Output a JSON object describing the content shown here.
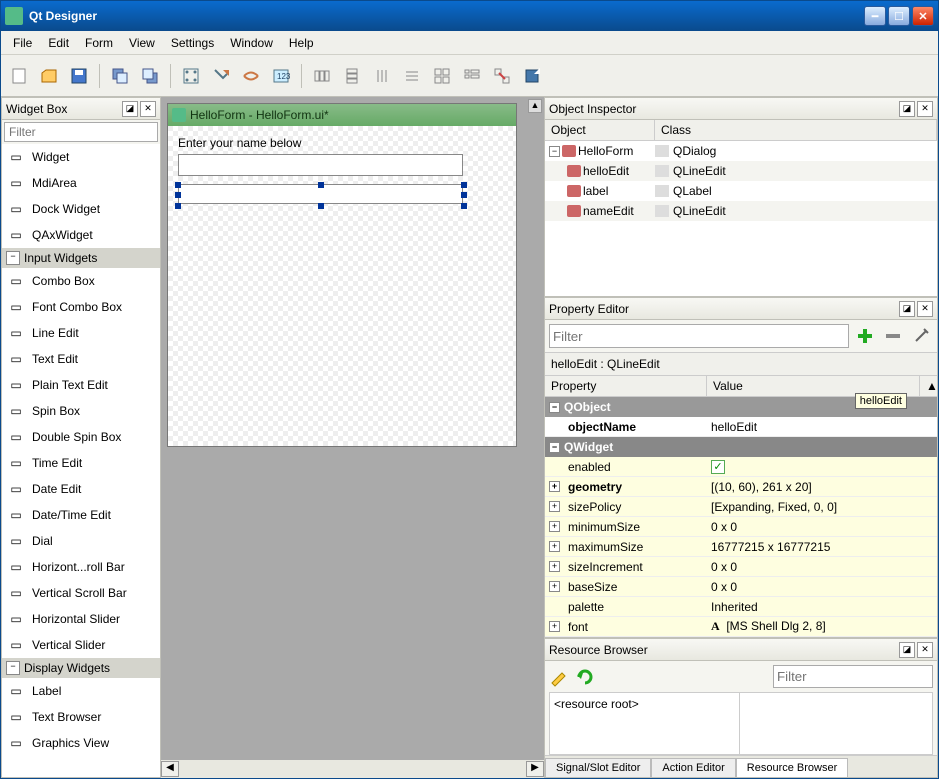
{
  "app_title": "Qt Designer",
  "menu": [
    "File",
    "Edit",
    "Form",
    "View",
    "Settings",
    "Window",
    "Help"
  ],
  "widgetbox": {
    "title": "Widget Box",
    "filter_placeholder": "Filter",
    "items": [
      {
        "icon": "widget-icon",
        "label": "Widget"
      },
      {
        "icon": "mdiarea-icon",
        "label": "MdiArea"
      },
      {
        "icon": "dockwidget-icon",
        "label": "Dock Widget"
      },
      {
        "icon": "axwidget-icon",
        "label": "QAxWidget"
      }
    ],
    "cat1": "Input Widgets",
    "input_items": [
      {
        "icon": "combobox-icon",
        "label": "Combo Box"
      },
      {
        "icon": "fontcombo-icon",
        "label": "Font Combo Box"
      },
      {
        "icon": "lineedit-icon",
        "label": "Line Edit"
      },
      {
        "icon": "textedit-icon",
        "label": "Text Edit"
      },
      {
        "icon": "plaintext-icon",
        "label": "Plain Text Edit"
      },
      {
        "icon": "spinbox-icon",
        "label": "Spin Box"
      },
      {
        "icon": "dspinbox-icon",
        "label": "Double Spin Box"
      },
      {
        "icon": "timeedit-icon",
        "label": "Time Edit"
      },
      {
        "icon": "dateedit-icon",
        "label": "Date Edit"
      },
      {
        "icon": "datetime-icon",
        "label": "Date/Time Edit"
      },
      {
        "icon": "dial-icon",
        "label": "Dial"
      },
      {
        "icon": "hscroll-icon",
        "label": "Horizont...roll Bar"
      },
      {
        "icon": "vscroll-icon",
        "label": "Vertical Scroll Bar"
      },
      {
        "icon": "hslider-icon",
        "label": "Horizontal Slider"
      },
      {
        "icon": "vslider-icon",
        "label": "Vertical Slider"
      }
    ],
    "cat2": "Display Widgets",
    "display_items": [
      {
        "icon": "label-icon",
        "label": "Label"
      },
      {
        "icon": "textbrowser-icon",
        "label": "Text Browser"
      },
      {
        "icon": "graphics-icon",
        "label": "Graphics View"
      }
    ]
  },
  "form": {
    "title": "HelloForm - HelloForm.ui*",
    "label_text": "Enter your name below"
  },
  "object_inspector": {
    "title": "Object Inspector",
    "col_object": "Object",
    "col_class": "Class",
    "rows": [
      {
        "indent": 0,
        "name": "HelloForm",
        "cls": "QDialog",
        "expanded": true,
        "icon": "dialog-icon"
      },
      {
        "indent": 1,
        "name": "helloEdit",
        "cls": "QLineEdit",
        "icon": "lineedit-icon"
      },
      {
        "indent": 1,
        "name": "label",
        "cls": "QLabel",
        "icon": "label-icon"
      },
      {
        "indent": 1,
        "name": "nameEdit",
        "cls": "QLineEdit",
        "icon": "lineedit-icon"
      }
    ]
  },
  "property_editor": {
    "title": "Property Editor",
    "filter_placeholder": "Filter",
    "selection": "helloEdit : QLineEdit",
    "col_prop": "Property",
    "col_val": "Value",
    "tooltip": "helloEdit",
    "groups": [
      {
        "name": "QObject",
        "rows": [
          {
            "name": "objectName",
            "value": "helloEdit",
            "bold": true
          }
        ]
      },
      {
        "name": "QWidget",
        "rows": [
          {
            "name": "enabled",
            "value": "checked",
            "checkbox": true
          },
          {
            "name": "geometry",
            "value": "[(10, 60), 261 x 20]",
            "bold": true,
            "expand": true
          },
          {
            "name": "sizePolicy",
            "value": "[Expanding, Fixed, 0, 0]",
            "expand": true
          },
          {
            "name": "minimumSize",
            "value": "0 x 0",
            "expand": true
          },
          {
            "name": "maximumSize",
            "value": "16777215 x 16777215",
            "expand": true
          },
          {
            "name": "sizeIncrement",
            "value": "0 x 0",
            "expand": true
          },
          {
            "name": "baseSize",
            "value": "0 x 0",
            "expand": true
          },
          {
            "name": "palette",
            "value": "Inherited"
          },
          {
            "name": "font",
            "value": "[MS Shell Dlg 2, 8]",
            "expand": true,
            "font_icon": true
          }
        ]
      }
    ]
  },
  "resource_browser": {
    "title": "Resource Browser",
    "filter_placeholder": "Filter",
    "root": "<resource root>",
    "tabs": [
      "Signal/Slot Editor",
      "Action Editor",
      "Resource Browser"
    ],
    "active_tab": 2
  }
}
